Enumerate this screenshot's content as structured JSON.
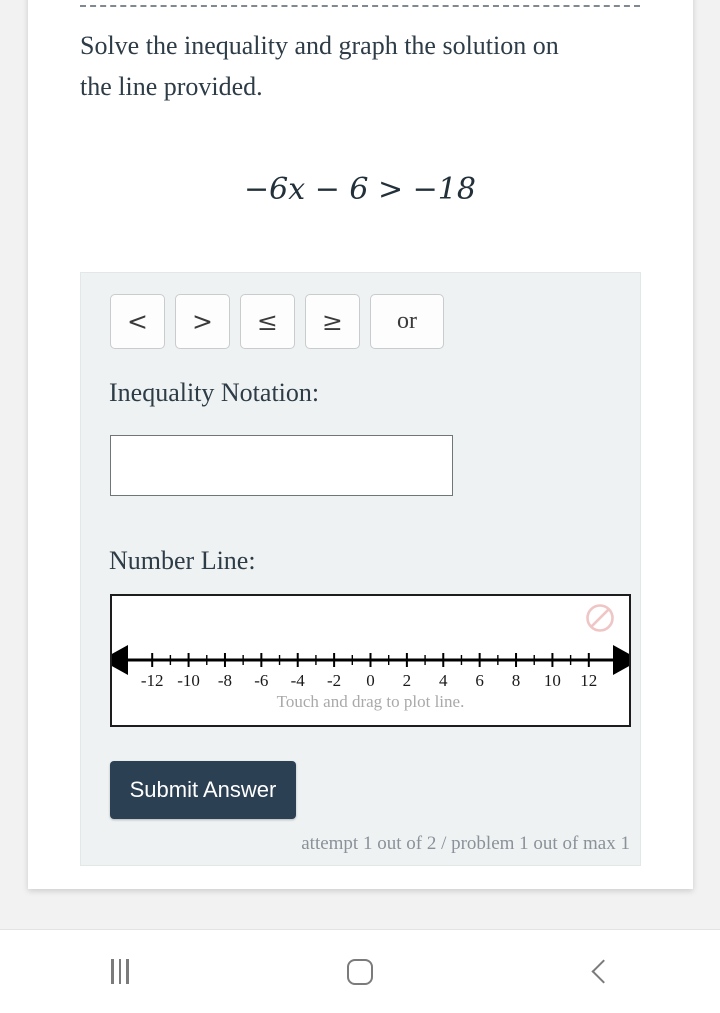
{
  "problem": {
    "instruction": "Solve the inequality and graph the solution on the line provided.",
    "equation": "−6x − 6 > −18"
  },
  "answer_panel": {
    "operator_buttons": [
      {
        "label": "<",
        "name": "less-than"
      },
      {
        "label": ">",
        "name": "greater-than"
      },
      {
        "label": "≤",
        "name": "less-than-or-equal"
      },
      {
        "label": "≥",
        "name": "greater-than-or-equal"
      },
      {
        "label": "or",
        "name": "or"
      }
    ],
    "notation_label": "Inequality Notation:",
    "notation_value": "",
    "notation_placeholder": "",
    "numberline_label": "Number Line:",
    "plot_hint": "Touch and drag to plot line.",
    "clear_icon": "no-entry-icon",
    "submit_label": "Submit Answer",
    "attempt_status": "attempt 1 out of 2 / problem 1 out of max 1"
  },
  "number_line": {
    "min": -13,
    "max": 13,
    "major_step": 2,
    "minor_step": 1,
    "labels": [
      "-12",
      "-10",
      "-8",
      "-6",
      "-4",
      "-2",
      "0",
      "2",
      "4",
      "6",
      "8",
      "10",
      "12"
    ],
    "label_values": [
      -12,
      -10,
      -8,
      -6,
      -4,
      -2,
      0,
      2,
      4,
      6,
      8,
      10,
      12
    ],
    "arrows": "both",
    "plotted": false
  },
  "nav_bar": {
    "recents": "recents-icon",
    "home": "home-icon",
    "back": "back-icon"
  },
  "colors": {
    "panel_bg": "#eef2f2",
    "text": "#2d3c47",
    "submit_bg": "#2c4054",
    "muted": "#8a9199",
    "clear_icon": "#f0c5c5"
  }
}
